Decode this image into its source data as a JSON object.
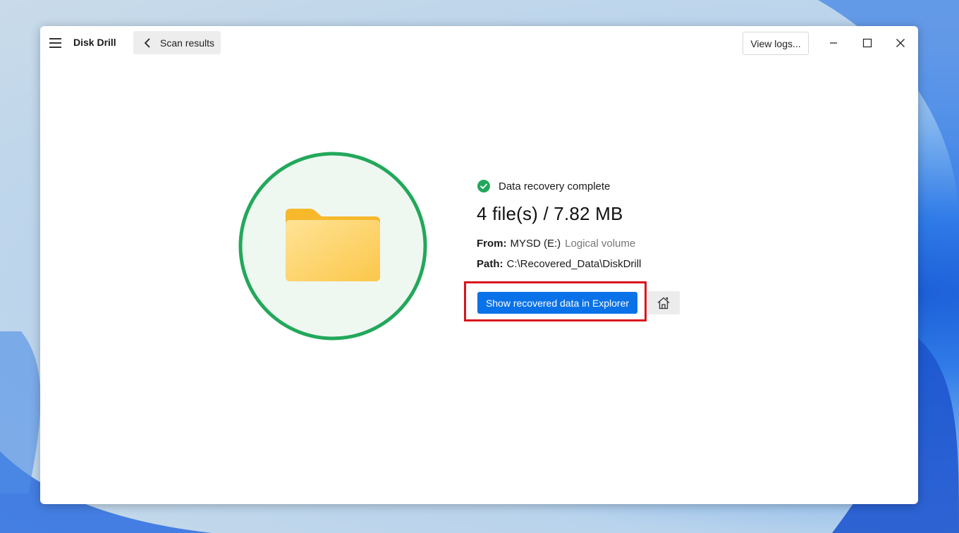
{
  "window": {
    "app_title": "Disk Drill",
    "back_label": "Scan results",
    "view_logs_label": "View logs..."
  },
  "result": {
    "status": "Data recovery complete",
    "summary": "4 file(s) / 7.82 MB",
    "from_label": "From:",
    "from_value": "MYSD (E:)",
    "from_volume_type": "Logical volume",
    "path_label": "Path:",
    "path_value": "C:\\Recovered_Data\\DiskDrill",
    "show_button_label": "Show recovered data in Explorer"
  },
  "colors": {
    "accent": "#0a72e8",
    "success": "#22a85a",
    "highlight": "#d9141e",
    "folder": "#fbc74a"
  },
  "icons": {
    "menu": "hamburger-icon",
    "back": "chevron-left-icon",
    "minimize": "minimize-icon",
    "maximize": "maximize-icon",
    "close": "close-icon",
    "status": "check-circle-icon",
    "hero": "folder-icon",
    "home": "home-icon"
  }
}
